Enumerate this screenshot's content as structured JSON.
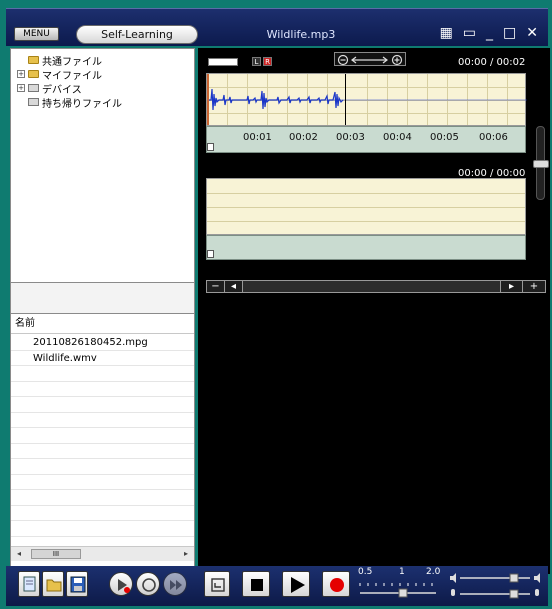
{
  "header": {
    "menu_label": "MENU",
    "mode_label": "Self-Learning",
    "file_title": "Wildlife.mp3"
  },
  "tree": {
    "items": [
      {
        "label": "共通ファイル",
        "icon": "folder-icon"
      },
      {
        "label": "マイファイル",
        "icon": "folder-icon"
      },
      {
        "label": "デバイス",
        "icon": "device-icon"
      },
      {
        "label": "持ち帰りファイル",
        "icon": "device-icon"
      }
    ]
  },
  "files": {
    "header": "名前",
    "items": [
      "20110826180452.mpg",
      "Wildlife.wmv"
    ],
    "scroll_thumb_label": "III"
  },
  "player": {
    "time_top": "00:00 / 00:02",
    "time_bottom": "00:00 / 00:00",
    "timeline_ticks": [
      "00:01",
      "00:02",
      "00:03",
      "00:04",
      "00:05",
      "00:06"
    ],
    "channel_left": "L",
    "channel_right": "R"
  },
  "speed": {
    "labels": [
      "0.5",
      "1",
      "2.0"
    ],
    "value": 1
  },
  "colors": {
    "frame": "#0f7b70",
    "titlebar": "#1d2f6e",
    "wave_bg": "#f8f3d6",
    "wave_color": "#1b37c9",
    "timeline_bg": "#c9dbd0",
    "record": "#e50000"
  },
  "icons": {
    "minimize": "minimize-icon",
    "close": "close-icon",
    "zoom_in": "zoom-in-icon",
    "zoom_out": "zoom-out-icon",
    "play": "play-icon",
    "stop": "stop-icon",
    "record": "record-icon"
  }
}
